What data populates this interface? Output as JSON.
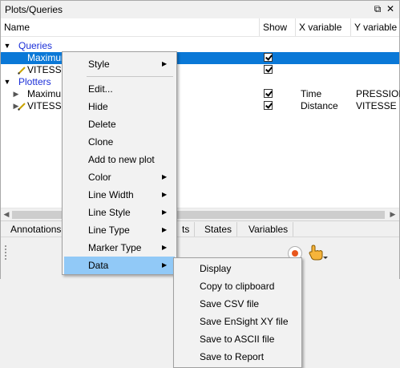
{
  "panel": {
    "title": "Plots/Queries",
    "float_icon": "restore-icon",
    "close_icon": "close-icon"
  },
  "columns": [
    "Name",
    "Show",
    "X variable",
    "Y variable"
  ],
  "tree": {
    "queries_group": "Queries",
    "query_items": [
      "Maximum",
      "VITESSE"
    ],
    "plotters_group": "Plotters",
    "plotter_items": [
      {
        "name": "Maximu",
        "x": "Time",
        "y": "PRESSION"
      },
      {
        "name": "VITESSE",
        "x": "Distance",
        "y": "VITESSE"
      }
    ]
  },
  "tabs": [
    "Annotations",
    "ts",
    "States",
    "Variables"
  ],
  "context_menu": {
    "items": [
      "Style",
      "Edit...",
      "Hide",
      "Delete",
      "Clone",
      "Add to new plot",
      "Color",
      "Line Width",
      "Line Style",
      "Line Type",
      "Marker Type",
      "Data"
    ]
  },
  "data_submenu": {
    "items": [
      "Display",
      "Copy to clipboard",
      "Save CSV file",
      "Save EnSight XY file",
      "Save to ASCII file",
      "Save to Report"
    ]
  },
  "colors": {
    "selection": "#0a78d7",
    "group_text": "#1a2ed8",
    "menu_highlight": "#91c9f7"
  }
}
